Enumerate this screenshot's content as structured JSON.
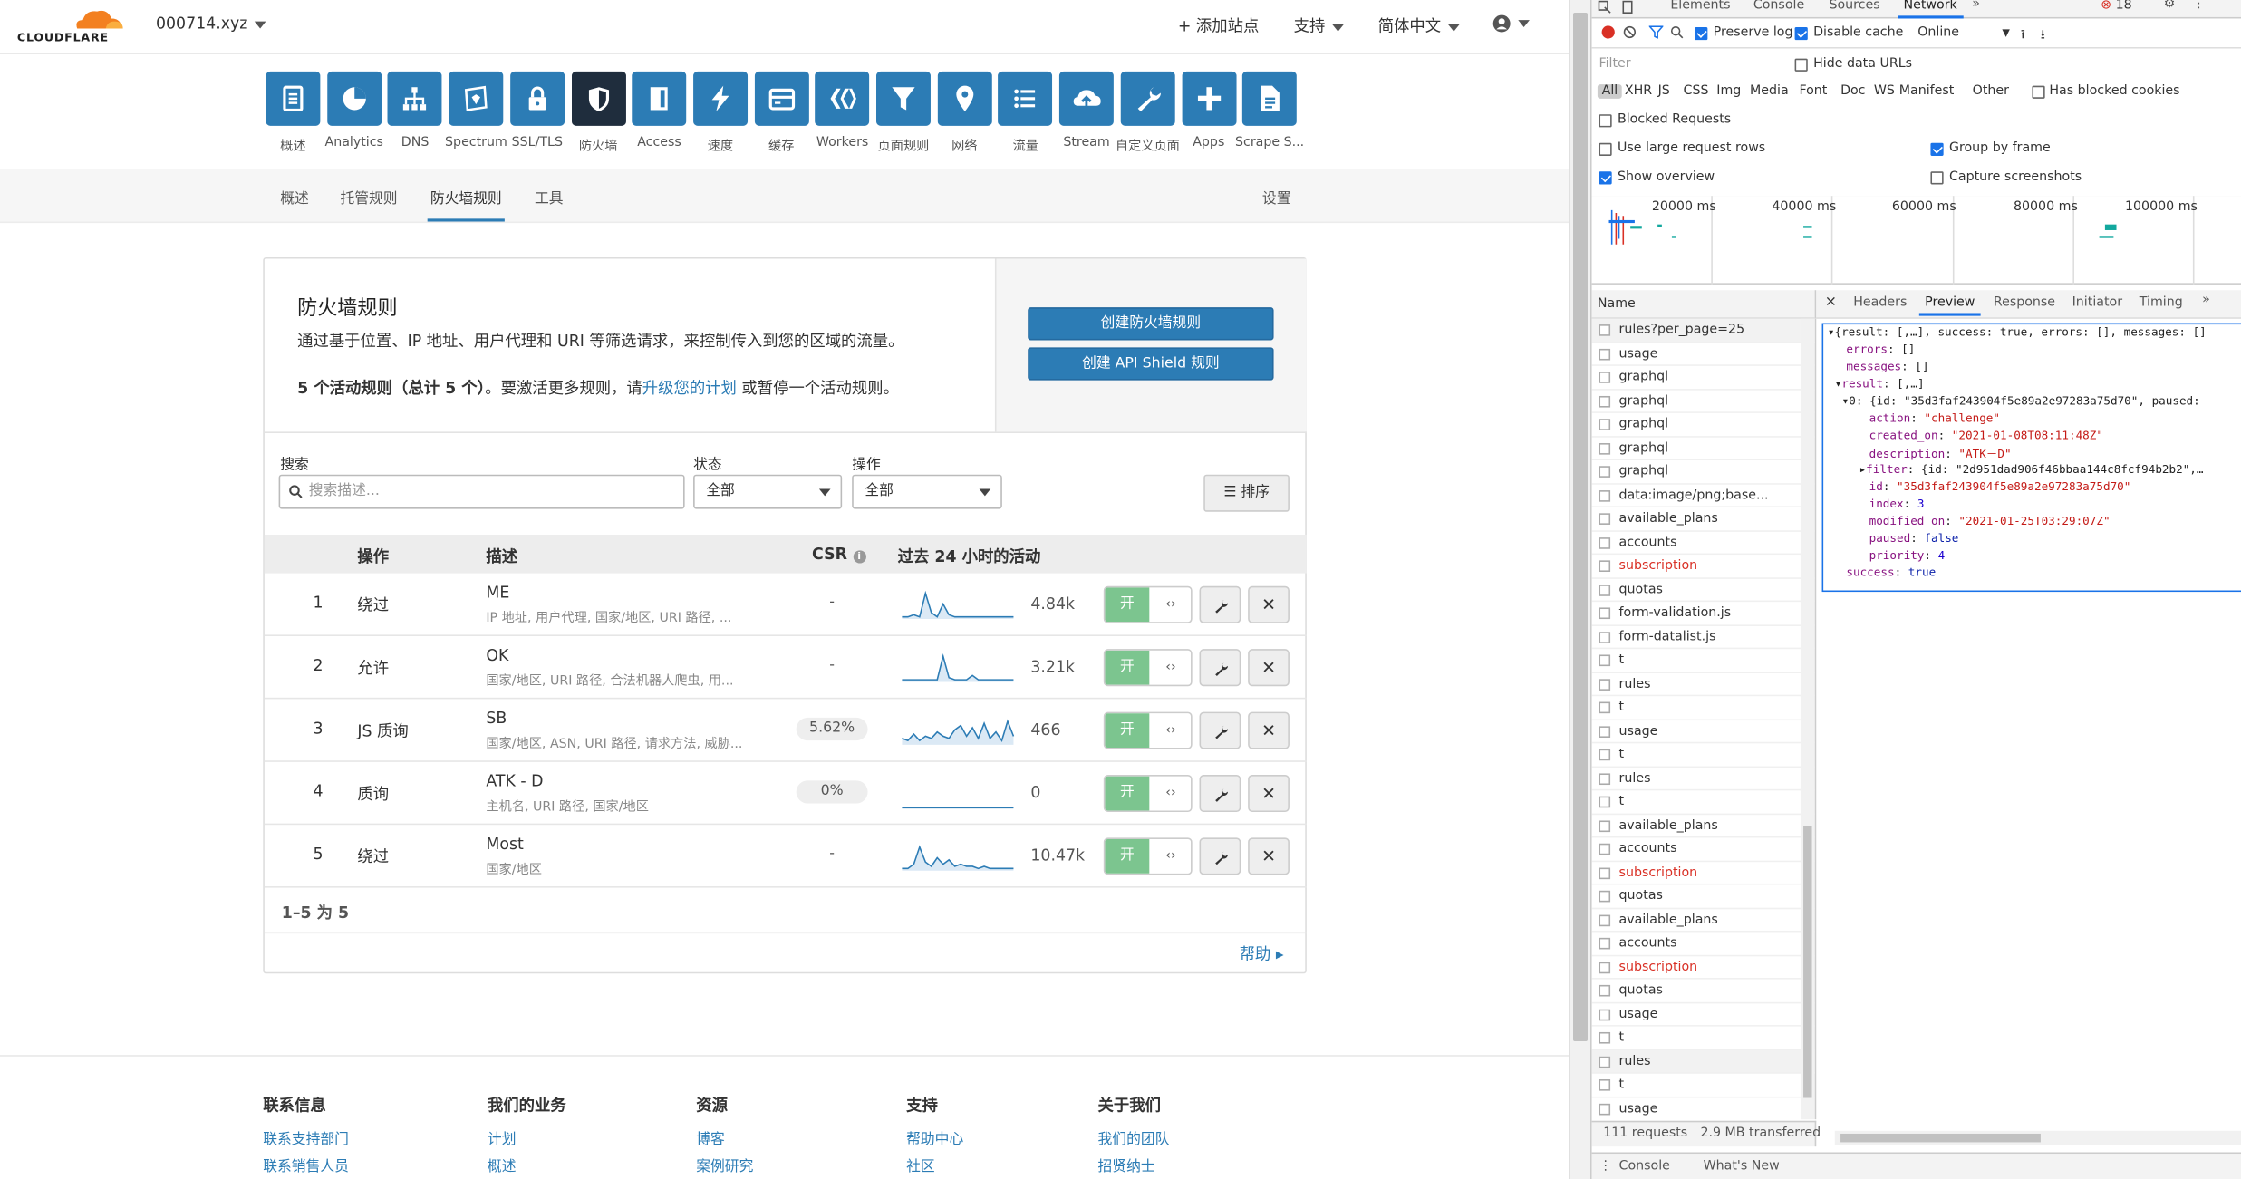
{
  "cf": {
    "logo_text": "CLOUDFLARE",
    "account": "000714.xyz",
    "topnav": {
      "add_site": "+ 添加站点",
      "support": "支持",
      "language": "简体中文"
    },
    "apps": [
      {
        "label": "概述",
        "icon": "overview-icon"
      },
      {
        "label": "Analytics",
        "icon": "analytics-icon"
      },
      {
        "label": "DNS",
        "icon": "dns-icon"
      },
      {
        "label": "Spectrum",
        "icon": "spectrum-icon"
      },
      {
        "label": "SSL/TLS",
        "icon": "lock-icon"
      },
      {
        "label": "防火墙",
        "icon": "shield-icon"
      },
      {
        "label": "Access",
        "icon": "access-icon"
      },
      {
        "label": "速度",
        "icon": "lightning-icon"
      },
      {
        "label": "缓存",
        "icon": "cache-icon"
      },
      {
        "label": "Workers",
        "icon": "workers-icon"
      },
      {
        "label": "页面规则",
        "icon": "filter-icon"
      },
      {
        "label": "网络",
        "icon": "location-icon"
      },
      {
        "label": "流量",
        "icon": "list-icon"
      },
      {
        "label": "Stream",
        "icon": "cloud-upload-icon"
      },
      {
        "label": "自定义页面",
        "icon": "wrench-icon"
      },
      {
        "label": "Apps",
        "icon": "plus-icon"
      },
      {
        "label": "Scrape S...",
        "icon": "document-icon"
      }
    ],
    "subnav": {
      "tabs": [
        "概述",
        "托管规则",
        "防火墙规则",
        "工具"
      ],
      "settings": "设置"
    },
    "card": {
      "title": "防火墙规则",
      "description": "通过基于位置、IP 地址、用户代理和 URI 等筛选请求，来控制传入到您的区域的流量。",
      "note_bold": "5 个活动规则（总计 5 个）",
      "note_mid": "。要激活更多规则，请",
      "note_link": "升级您的计划",
      "note_end": " 或暂停一个活动规则。",
      "btn_create": "创建防火墙规则",
      "btn_api": "创建 API Shield 规则"
    },
    "filters": {
      "search_label": "搜索",
      "search_placeholder": "搜索描述...",
      "status_label": "状态",
      "status_value": "全部",
      "action_label": "操作",
      "action_value": "全部",
      "sort": "排序"
    },
    "table": {
      "headers": {
        "action": "操作",
        "desc": "描述",
        "csr": "CSR",
        "activity": "过去 24 小时的活动"
      },
      "rows": [
        {
          "num": "1",
          "action": "绕过",
          "name": "ME",
          "sub": "IP 地址, 用户代理, 国家/地区, URI 路径, ...",
          "csr": "-",
          "count": "4.84k",
          "on": "开",
          "activity": [
            1,
            1,
            2,
            1,
            12,
            3,
            1,
            7,
            2,
            1,
            1,
            1,
            1,
            1,
            1,
            1,
            1,
            1,
            1,
            1
          ]
        },
        {
          "num": "2",
          "action": "允许",
          "name": "OK",
          "sub": "国家/地区, URI 路径, 合法机器人爬虫, 用...",
          "csr": "-",
          "count": "3.21k",
          "on": "开",
          "activity": [
            1,
            1,
            1,
            1,
            1,
            1,
            1,
            12,
            2,
            1,
            1,
            1,
            3,
            1,
            1,
            1,
            1,
            1,
            1,
            1
          ]
        },
        {
          "num": "3",
          "action": "JS 质询",
          "name": "SB",
          "sub": "国家/地区, ASN, URI 路径, 请求方法, 威胁...",
          "csr": "5.62%",
          "count": "466",
          "on": "开",
          "activity": [
            3,
            2,
            5,
            2,
            4,
            3,
            6,
            4,
            3,
            7,
            9,
            4,
            8,
            3,
            10,
            3,
            6,
            2,
            11,
            4
          ]
        },
        {
          "num": "4",
          "action": "质询",
          "name": "ATK - D",
          "sub": "主机名, URI 路径, 国家/地区",
          "csr": "0%",
          "count": "0",
          "on": "开",
          "activity": [
            0,
            0,
            0,
            0,
            0,
            0,
            0,
            0,
            0,
            0,
            0,
            0,
            0,
            0,
            0,
            0,
            0,
            0,
            0,
            0
          ]
        },
        {
          "num": "5",
          "action": "绕过",
          "name": "Most",
          "sub": "国家/地区",
          "csr": "-",
          "count": "10.47k",
          "on": "开",
          "activity": [
            1,
            1,
            3,
            11,
            4,
            2,
            6,
            3,
            5,
            2,
            3,
            2,
            2,
            1,
            2,
            1,
            1,
            1,
            1,
            1
          ]
        }
      ]
    },
    "pager": "1–5 为 5",
    "help": "帮助",
    "footer": [
      {
        "head": "联系信息",
        "links": [
          "联系支持部门",
          "联系销售人员"
        ]
      },
      {
        "head": "我们的业务",
        "links": [
          "计划",
          "概述"
        ]
      },
      {
        "head": "资源",
        "links": [
          "博客",
          "案例研究"
        ]
      },
      {
        "head": "支持",
        "links": [
          "帮助中心",
          "社区"
        ]
      },
      {
        "head": "关于我们",
        "links": [
          "我们的团队",
          "招贤纳士"
        ]
      }
    ]
  },
  "devtools": {
    "tabs": [
      "Elements",
      "Console",
      "Sources",
      "Network"
    ],
    "error_count": "18",
    "preserve_log": "Preserve log",
    "disable_cache": "Disable cache",
    "throttle": "Online",
    "filter_placeholder": "Filter",
    "hide_data_urls": "Hide data URLs",
    "types": [
      "All",
      "XHR",
      "JS",
      "CSS",
      "Img",
      "Media",
      "Font",
      "Doc",
      "WS",
      "Manifest",
      "Other"
    ],
    "has_blocked_cookies": "Has blocked cookies",
    "blocked_requests": "Blocked Requests",
    "large_rows": "Use large request rows",
    "group_by_frame": "Group by frame",
    "show_overview": "Show overview",
    "capture_screenshots": "Capture screenshots",
    "timeline_ticks": [
      "20000 ms",
      "40000 ms",
      "60000 ms",
      "80000 ms",
      "100000 ms"
    ],
    "name_header": "Name",
    "detail_tabs": [
      "Headers",
      "Preview",
      "Response",
      "Initiator",
      "Timing"
    ],
    "requests": [
      {
        "name": "rules?per_page=25",
        "err": false
      },
      {
        "name": "usage",
        "err": false
      },
      {
        "name": "graphql",
        "err": false
      },
      {
        "name": "graphql",
        "err": false
      },
      {
        "name": "graphql",
        "err": false
      },
      {
        "name": "graphql",
        "err": false
      },
      {
        "name": "graphql",
        "err": false
      },
      {
        "name": "data:image/png;base...",
        "err": false
      },
      {
        "name": "available_plans",
        "err": false
      },
      {
        "name": "accounts",
        "err": false
      },
      {
        "name": "subscription",
        "err": true
      },
      {
        "name": "quotas",
        "err": false
      },
      {
        "name": "form-validation.js",
        "err": false
      },
      {
        "name": "form-datalist.js",
        "err": false
      },
      {
        "name": "t",
        "err": false
      },
      {
        "name": "rules",
        "err": false
      },
      {
        "name": "t",
        "err": false
      },
      {
        "name": "usage",
        "err": false
      },
      {
        "name": "t",
        "err": false
      },
      {
        "name": "rules",
        "err": false
      },
      {
        "name": "t",
        "err": false
      },
      {
        "name": "available_plans",
        "err": false
      },
      {
        "name": "accounts",
        "err": false
      },
      {
        "name": "subscription",
        "err": true
      },
      {
        "name": "quotas",
        "err": false
      },
      {
        "name": "available_plans",
        "err": false
      },
      {
        "name": "accounts",
        "err": false
      },
      {
        "name": "subscription",
        "err": true
      },
      {
        "name": "quotas",
        "err": false
      },
      {
        "name": "usage",
        "err": false
      },
      {
        "name": "t",
        "err": false
      },
      {
        "name": "rules",
        "err": false
      },
      {
        "name": "t",
        "err": false
      },
      {
        "name": "usage",
        "err": false
      }
    ],
    "status_requests": "111 requests",
    "status_transferred": "2.9 MB transferred",
    "preview": {
      "line0": "{result: [,…], success: true, errors: [], messages: []",
      "errors": "[]",
      "messages": "[]",
      "result": "[,…]",
      "item0_prefix": "0: {id: \"35d3faf243904f5e89a2e97283a75d70\", paused:",
      "action": "\"challenge\"",
      "created_on": "\"2021-01-08T08:11:48Z\"",
      "description": "\"ATK－D\"",
      "filter": "{id: \"2d951dad906f46bbaa144c8fcf94b2b2\",…",
      "id": "\"35d3faf243904f5e89a2e97283a75d70\"",
      "index": "3",
      "modified_on": "\"2021-01-25T03:29:07Z\"",
      "paused": "false",
      "priority": "4",
      "success": "true"
    },
    "drawer_tabs": [
      "Console",
      "What's New"
    ]
  }
}
